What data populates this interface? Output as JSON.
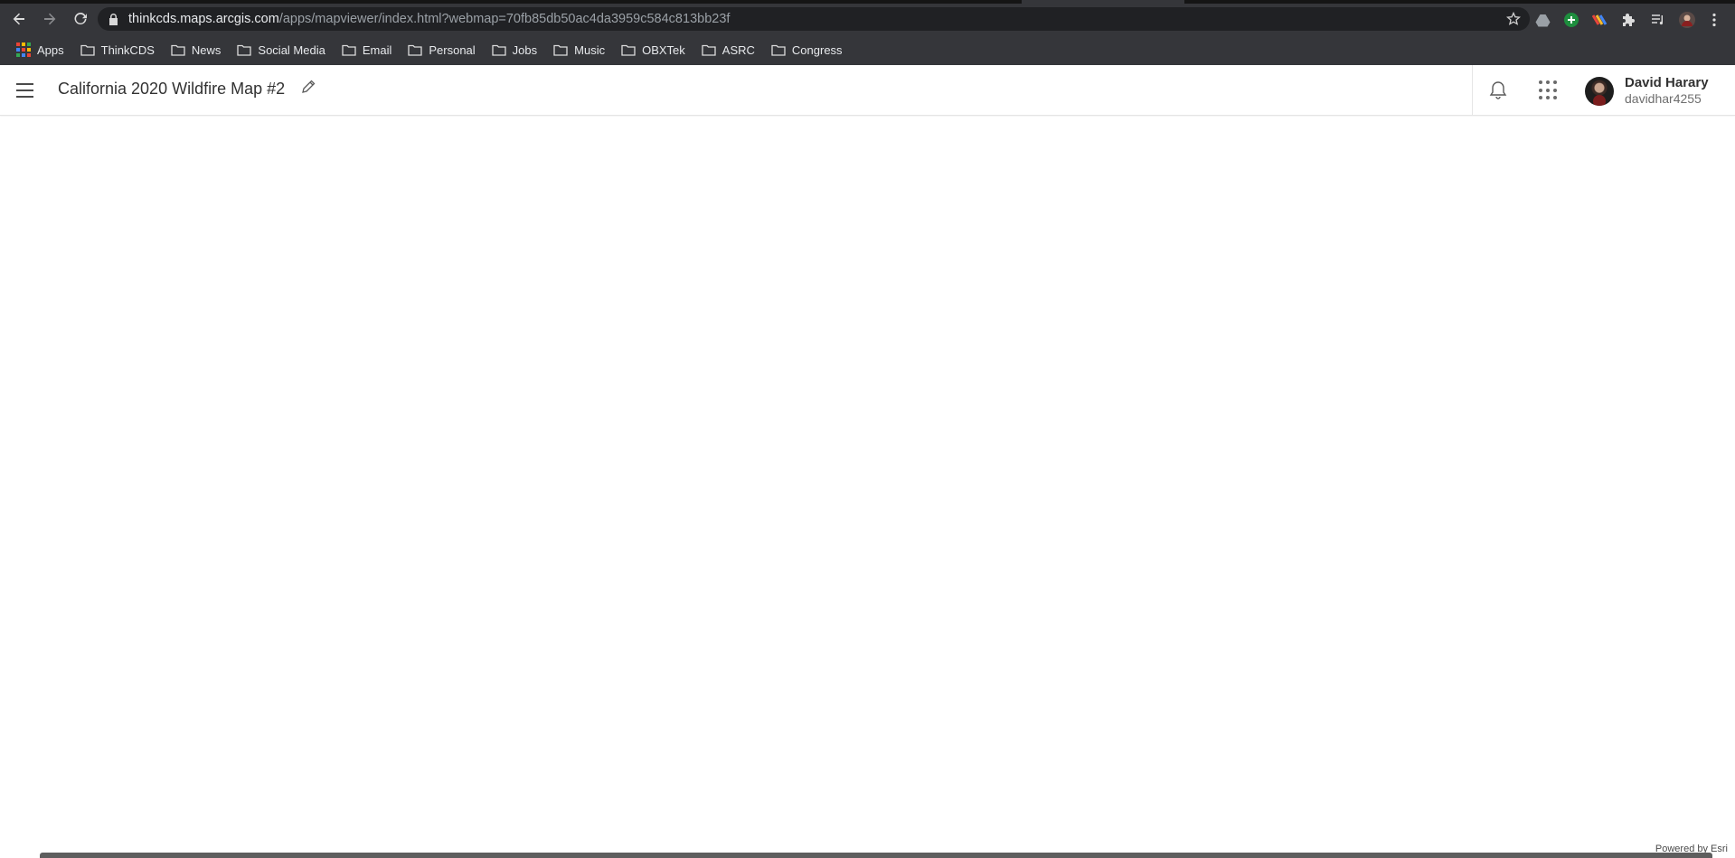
{
  "browser": {
    "url_host": "thinkcds.maps.arcgis.com",
    "url_path": "/apps/mapviewer/index.html?webmap=70fb85db50ac4da3959c584c813bb23f",
    "bookmarks": [
      {
        "label": "Apps",
        "icon": "apps-grid-icon"
      },
      {
        "label": "ThinkCDS",
        "icon": "folder-icon"
      },
      {
        "label": "News",
        "icon": "folder-icon"
      },
      {
        "label": "Social Media",
        "icon": "folder-icon"
      },
      {
        "label": "Email",
        "icon": "folder-icon"
      },
      {
        "label": "Personal",
        "icon": "folder-icon"
      },
      {
        "label": "Jobs",
        "icon": "folder-icon"
      },
      {
        "label": "Music",
        "icon": "folder-icon"
      },
      {
        "label": "OBXTek",
        "icon": "folder-icon"
      },
      {
        "label": "ASRC",
        "icon": "folder-icon"
      },
      {
        "label": "Congress",
        "icon": "folder-icon"
      }
    ]
  },
  "header": {
    "map_title": "California 2020 Wildfire Map #2",
    "user_name": "David Harary",
    "user_id": "davidhar4255"
  },
  "map": {
    "attribution": "Powered by Esri"
  },
  "colors": {
    "chrome_toolbar": "#35363a",
    "omnibox": "#202124",
    "header_text": "#323232"
  }
}
